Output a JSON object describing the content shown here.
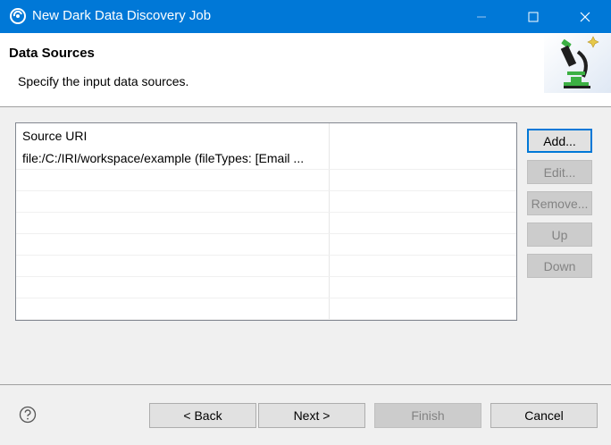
{
  "window": {
    "title": "New Dark Data Discovery Job"
  },
  "banner": {
    "heading": "Data Sources",
    "description": "Specify the input data sources."
  },
  "table": {
    "header": "Source URI",
    "rows": [
      "file:/C:/IRI/workspace/example (fileTypes: [Email ..."
    ]
  },
  "side_buttons": {
    "add": "Add...",
    "edit": "Edit...",
    "remove": "Remove...",
    "up": "Up",
    "down": "Down"
  },
  "footer": {
    "back": "< Back",
    "next": "Next >",
    "finish": "Finish",
    "cancel": "Cancel"
  },
  "colors": {
    "titlebar": "#0078d7",
    "logo_green": "#3cb043",
    "logo_dark": "#1f1f1f"
  }
}
